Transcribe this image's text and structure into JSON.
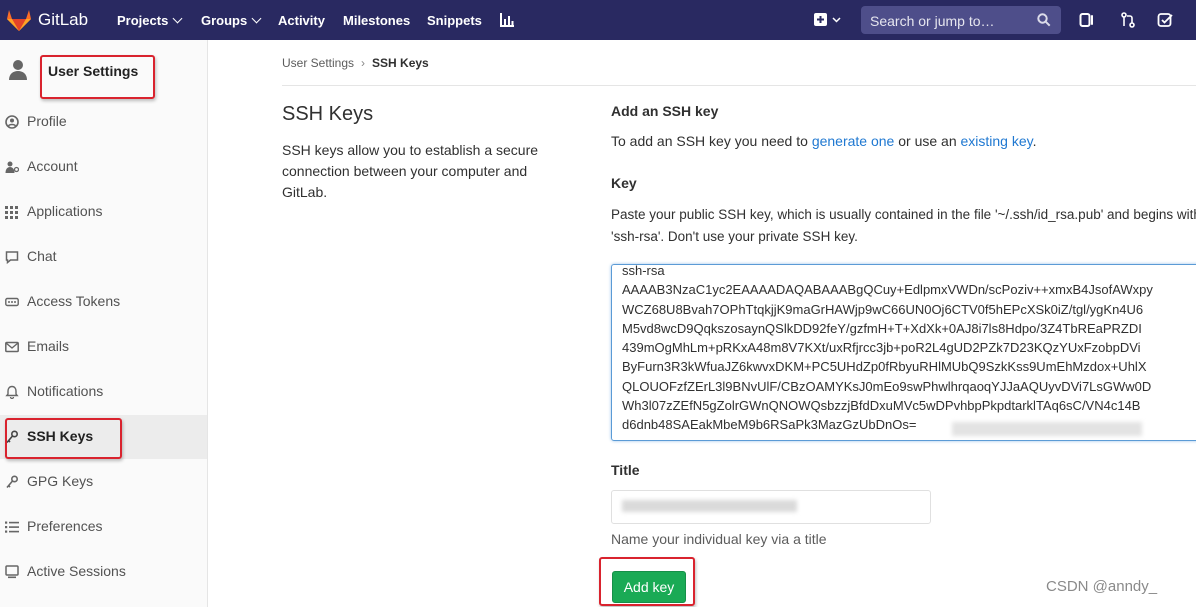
{
  "navbar": {
    "brand": "GitLab",
    "items": [
      {
        "label": "Projects"
      },
      {
        "label": "Groups"
      },
      {
        "label": "Activity"
      },
      {
        "label": "Milestones"
      },
      {
        "label": "Snippets"
      }
    ],
    "search_placeholder": "Search or jump to…",
    "color": "#292961"
  },
  "sidebar": {
    "title": "User Settings",
    "items": [
      {
        "label": "Profile",
        "icon": "profile-icon"
      },
      {
        "label": "Account",
        "icon": "account-icon"
      },
      {
        "label": "Applications",
        "icon": "applications-icon"
      },
      {
        "label": "Chat",
        "icon": "chat-icon"
      },
      {
        "label": "Access Tokens",
        "icon": "access-tokens-icon"
      },
      {
        "label": "Emails",
        "icon": "emails-icon"
      },
      {
        "label": "Notifications",
        "icon": "notifications-icon"
      },
      {
        "label": "SSH Keys",
        "icon": "key-icon",
        "active": true
      },
      {
        "label": "GPG Keys",
        "icon": "key-icon"
      },
      {
        "label": "Preferences",
        "icon": "preferences-icon"
      },
      {
        "label": "Active Sessions",
        "icon": "sessions-icon"
      }
    ]
  },
  "breadcrumb": {
    "parent": "User Settings",
    "current": "SSH Keys"
  },
  "section": {
    "title": "SSH Keys",
    "description": "SSH keys allow you to establish a secure connection between your computer and GitLab."
  },
  "form": {
    "heading": "Add an SSH key",
    "intro_prefix": "To add an SSH key you need to ",
    "generate_link": "generate one",
    "intro_middle": " or use an ",
    "existing_link": "existing key",
    "intro_suffix": ".",
    "key_label": "Key",
    "key_help": "Paste your public SSH key, which is usually contained in the file '~/.ssh/id_rsa.pub' and begins with 'ssh-rsa'. Don't use your private SSH key.",
    "key_value": "ssh-rsa\nAAAAB3NzaC1yc2EAAAADAQABAAABgQCuy+EdlpmxVWDn/scPoziv++xmxB4JsofAWxpy\nWCZ68U8Bvah7OPhTtqkjjK9maGrHAWjp9wC66UN0Oj6CTV0f5hEPcXSk0iZ/tgl/ygKn4U6\nM5vd8wcD9QqkszosaynQSlkDD92feY/gzfmH+T+XdXk+0AJ8i7ls8Hdpo/3Z4TbREaPRZDI\n439mOgMhLm+pRKxA48m8V7KXt/uxRfjrcc3jb+poR2L4gUD2PZk7D23KQzYUxFzobpDVi\nByFurn3R3kWfuaJZ6kwvxDKM+PC5UHdZp0fRbyuRHlMUbQ9SzkKss9UmEhMzdox+UhlX\nQLOUOFzfZErL3l9BNvUlF/CBzOAMYKsJ0mEo9swPhwlhrqaoqYJJaAQUyvDVi7LsGWw0D\nWh3l07zZEfN5gZolrGWnQNOWQsbzzjBfdDxuMVc5wDPvhbpPkpdtarklTAq6sC/VN4c14B\nd6dnb48SAEakMbeM9b6RSaPk3MazGzUbDnOs=",
    "title_label": "Title",
    "title_help": "Name your individual key via a title",
    "submit_label": "Add key",
    "submit_color": "#1aaa55"
  },
  "watermark": "CSDN @anndy_",
  "annotation_color": "#d9232e"
}
